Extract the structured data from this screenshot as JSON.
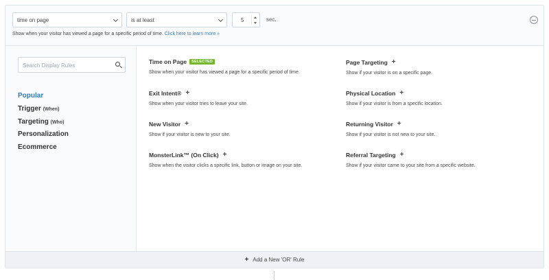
{
  "rule": {
    "field_select": "time on page",
    "operator_select": "is at least",
    "number_value": "5",
    "unit": "sec.",
    "help_text": "Show when your visitor has viewed a page for a specific period of time.",
    "help_link": "Click here to learn more »"
  },
  "sidebar": {
    "search_placeholder": "Search Display Rules",
    "categories": [
      {
        "label": "Popular",
        "sub": ""
      },
      {
        "label": "Trigger",
        "sub": "(When)"
      },
      {
        "label": "Targeting",
        "sub": "(Who)"
      },
      {
        "label": "Personalization",
        "sub": ""
      },
      {
        "label": "Ecommerce",
        "sub": ""
      }
    ]
  },
  "rules": [
    {
      "title": "Time on Page",
      "badge": "SELECTED",
      "desc": "Show when your visitor has viewed a page for a specific period of time."
    },
    {
      "title": "Page Targeting",
      "plus": "+",
      "desc": "Show if your visitor is on a specific page."
    },
    {
      "title": "Exit Intent®",
      "plus": "+",
      "desc": "Show when your visitor tries to leave your site."
    },
    {
      "title": "Physical Location",
      "plus": "+",
      "desc": "Show if your visitor is from a specific location."
    },
    {
      "title": "New Visitor",
      "plus": "+",
      "desc": "Show if your visitor is new to your site."
    },
    {
      "title": "Returning Visitor",
      "plus": "+",
      "desc": "Show if your visitor is not new to your site."
    },
    {
      "title": "MonsterLink™ (On Click)",
      "plus": "+",
      "desc": "Show when the visitor clicks a specific link, button or image on your site."
    },
    {
      "title": "Referral Targeting",
      "plus": "+",
      "desc": "Show if your visitor came to your site from a specific website."
    }
  ],
  "footer": {
    "add_or_plus": "+",
    "add_or_label": "Add a New 'OR' Rule"
  },
  "colors": {
    "accent": "#2d7ec4",
    "badge": "#74b72e"
  },
  "icons": {
    "remove": "minus-circle-icon",
    "search": "search-icon",
    "chevron": "chevron-down-icon"
  }
}
